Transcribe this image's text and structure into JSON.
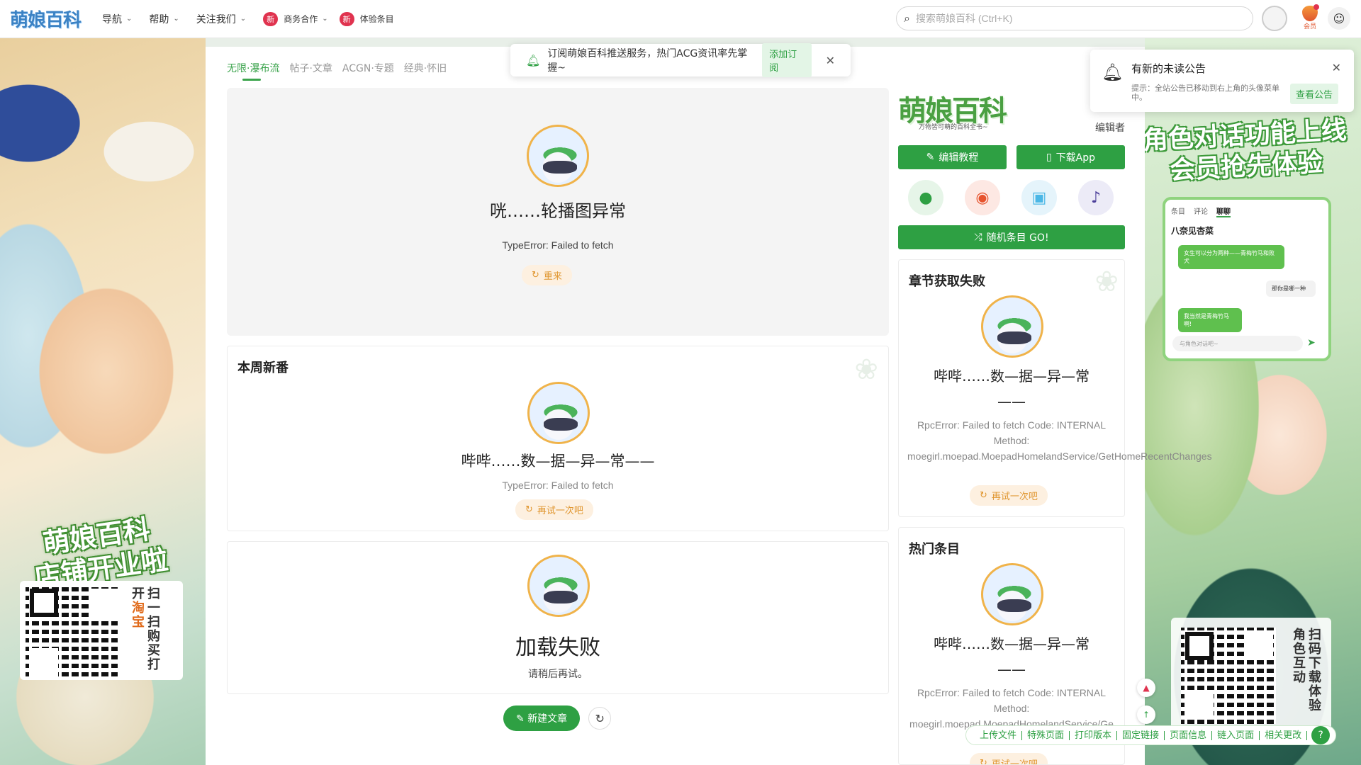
{
  "header": {
    "logo": "萌娘百科",
    "nav": [
      {
        "label": "导航"
      },
      {
        "label": "帮助"
      },
      {
        "label": "关注我们"
      }
    ],
    "promo1": {
      "badge": "新",
      "label": "商务合作"
    },
    "promo2": {
      "badge": "新",
      "label": "体验条目"
    },
    "search_placeholder": "搜索萌娘百科 (Ctrl+K)",
    "vip_label": "会员"
  },
  "subscribe_bar": {
    "text": "订阅萌娘百科推送服务，热门ACG资讯率先掌握~",
    "button": "添加订阅"
  },
  "notice": {
    "title": "有新的未读公告",
    "tip": "提示：全站公告已移动到右上角的头像菜单中。",
    "button": "查看公告"
  },
  "tabs": [
    "无限·瀑布流",
    "帖子·文章",
    "ACGN·专题",
    "经典·怀旧"
  ],
  "carousel": {
    "title": "咣……轮播图异常",
    "message": "TypeError: Failed to fetch",
    "retry": "重来"
  },
  "weekly": {
    "title": "本周新番",
    "error": "哔哔……数—据—异—常——",
    "message": "TypeError: Failed to fetch",
    "retry": "再试一次吧"
  },
  "load_fail": {
    "title": "加载失败",
    "message": "请稍后再试。"
  },
  "actions": {
    "new_article": "新建文章"
  },
  "sidebar": {
    "logo": "萌娘百科",
    "subtitle": "万物皆可萌的百科全书~",
    "editor_label": "编辑者",
    "edit_tutorial": "编辑教程",
    "download_app": "下载App",
    "random": "随机条目 GO!",
    "chapter_card": {
      "title": "章节获取失败",
      "error": "哔哔……数—据—异—常——",
      "message": "RpcError: Failed to fetch Code: INTERNAL Method: moegirl.moepad.MoepadHomelandService/GetHomeRecentChanges",
      "retry": "再试一次吧"
    },
    "hot_card": {
      "title": "热门条目",
      "error": "哔哔……数—据—异—常——",
      "message": "RpcError: Failed to fetch Code: INTERNAL Method: moegirl.moepad.MoepadHomelandService/Ge",
      "retry": "再试一次吧"
    }
  },
  "left_ad": {
    "banner_line1": "萌娘百科",
    "banner_line2": "店铺开业啦",
    "qr_col1": "扫一扫购买",
    "qr_col2_a": "打开",
    "qr_col2_b": "淘宝"
  },
  "right_ad": {
    "banner_line1": "角色对话功能上线",
    "banner_line2": "会员抢先体验",
    "phone_tabs": [
      "条目",
      "评论",
      "聊聊"
    ],
    "phone_name": "八奈见杏菜",
    "bubble1": "女生可以分为两种——青梅竹马和败犬",
    "bubble2": "那你是哪一种",
    "bubble3": "我当然是青梅竹马啊!",
    "phone_input": "与角色对话吧~",
    "qr_col1": "扫码下载",
    "qr_col2": "体验角色互动"
  },
  "footer_toolbar": [
    "上传文件",
    "特殊页面",
    "打印版本",
    "固定链接",
    "页面信息",
    "链入页面",
    "相关更改"
  ],
  "colors": {
    "brand_green": "#2ea043",
    "logo_blue": "#3b82c4",
    "badge_red": "#e0334f"
  }
}
